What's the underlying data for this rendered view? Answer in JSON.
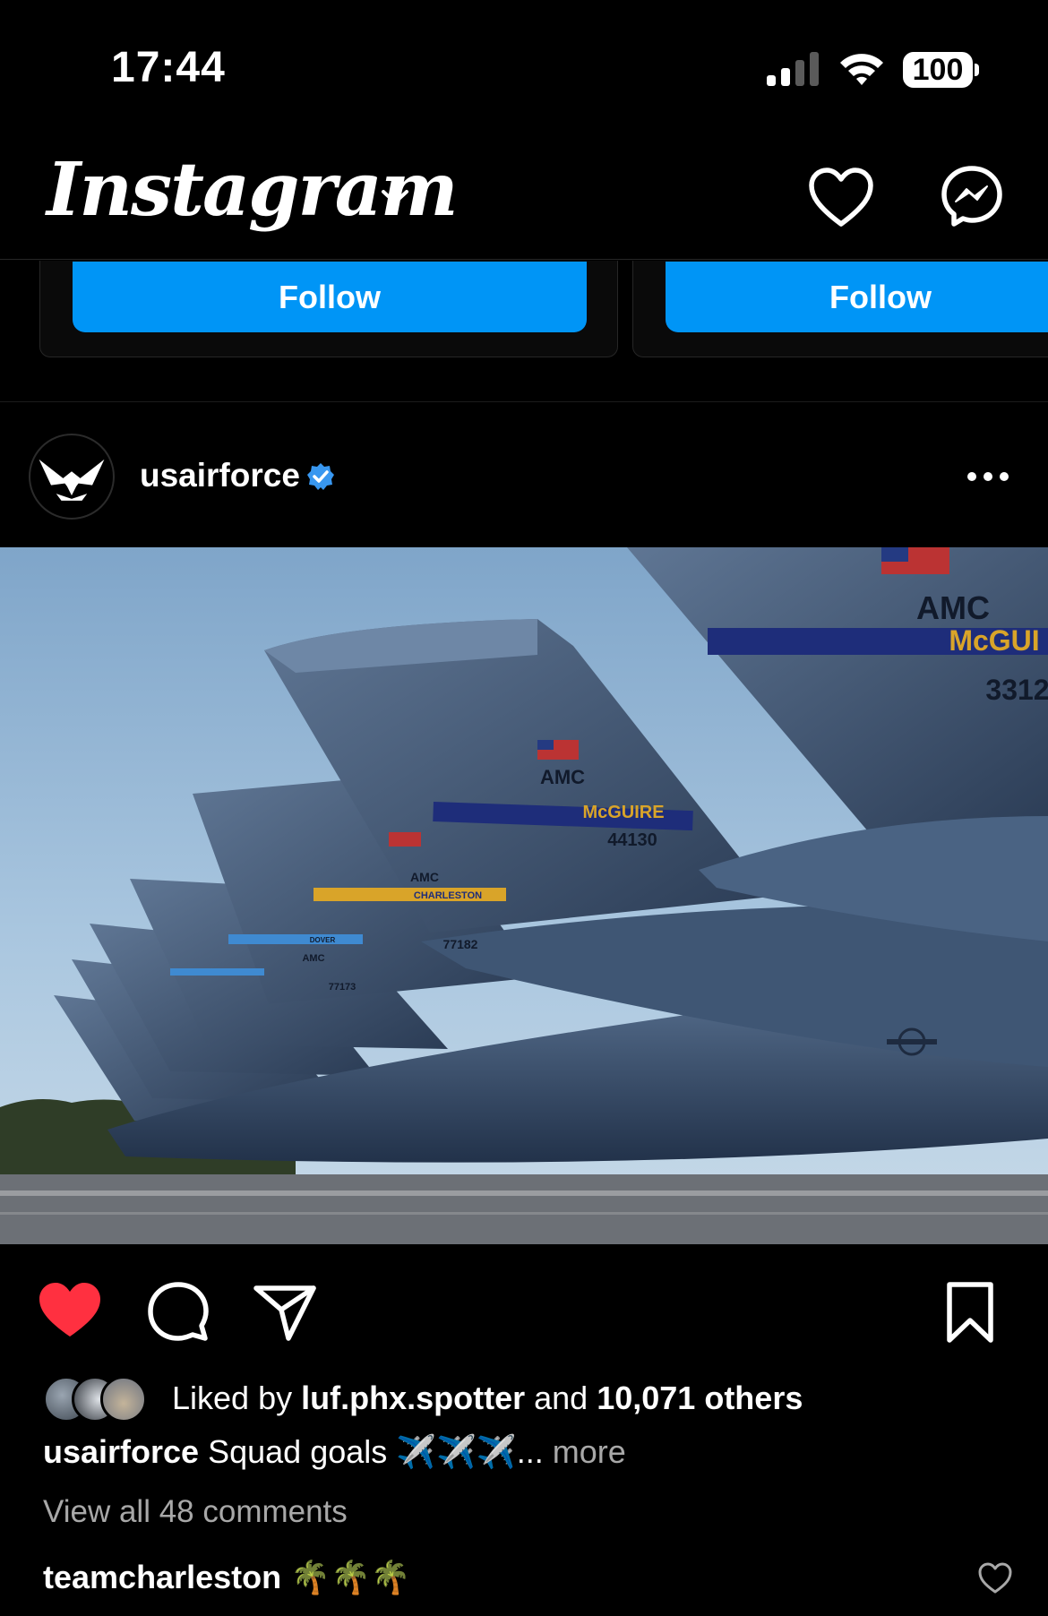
{
  "status": {
    "time": "17:44",
    "battery": "100",
    "signal_icon": "cellular-signal-icon",
    "wifi_icon": "wifi-icon"
  },
  "header": {
    "logo": "Instagram",
    "activity_icon": "heart-icon",
    "messages_icon": "messenger-icon"
  },
  "suggested": {
    "cards": [
      {
        "button": "Follow"
      },
      {
        "button": "Follow"
      }
    ]
  },
  "post": {
    "username": "usairforce",
    "verified": true,
    "photo_tail_labels": [
      "AMC",
      "McGUIRE",
      "44130",
      "AMC",
      "CHARLESTON",
      "77182",
      "AMC",
      "DOVER",
      "77173",
      "AMC",
      "McGUI",
      "3312"
    ],
    "liked_by_prefix": "Liked by",
    "liked_by_user": "luf.phx.spotter",
    "liked_by_and": "and",
    "liked_by_others": "10,071 others",
    "caption_user": "usairforce",
    "caption_text": "Squad goals ✈️✈️✈️...",
    "caption_more": "more",
    "view_comments": "View all 48 comments",
    "top_comment_user": "teamcharleston",
    "top_comment_text": "🌴🌴🌴"
  },
  "colors": {
    "background": "#000000",
    "follow_blue": "#0095f6",
    "like_red": "#ff3040",
    "verified_blue": "#3897f0",
    "secondary_text": "#a8a8a8"
  }
}
